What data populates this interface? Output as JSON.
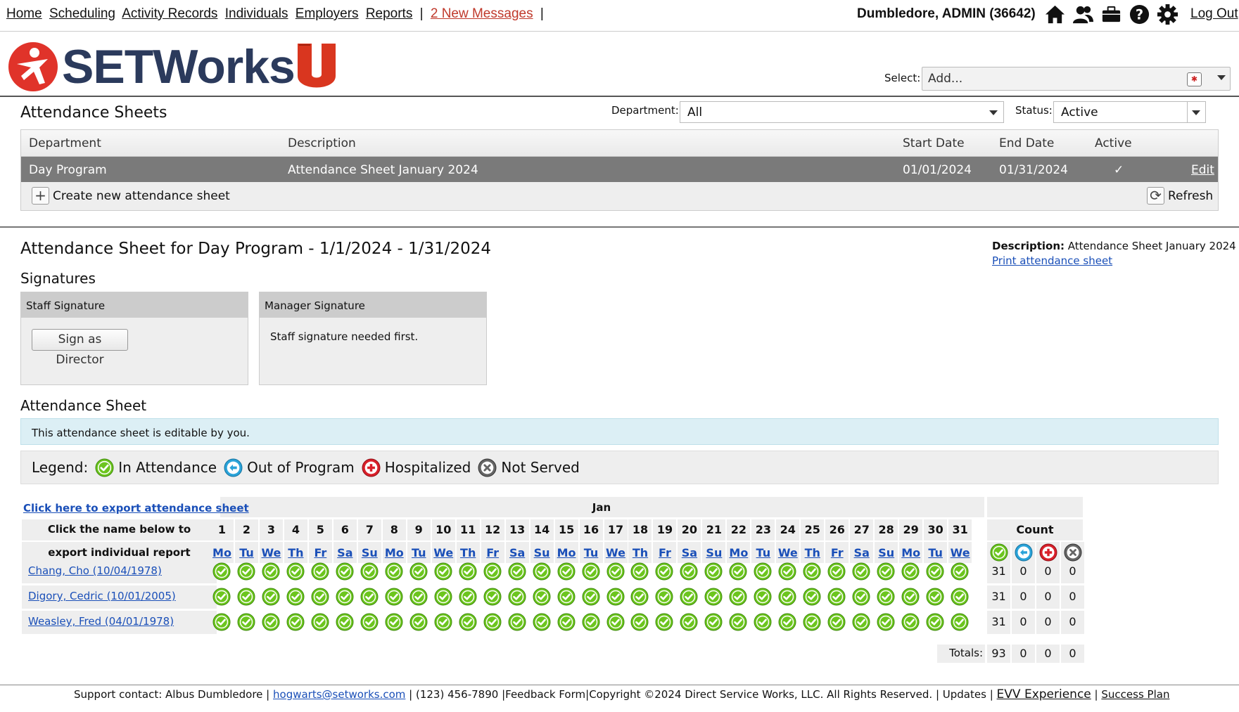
{
  "nav": {
    "links": [
      "Home",
      "Scheduling",
      "Activity Records",
      "Individuals",
      "Employers",
      "Reports"
    ],
    "messages": "2 New Messages",
    "user": "Dumbledore, ADMIN  (36642)",
    "logout": "Log Out",
    "icons": [
      "home-icon",
      "people-icon",
      "briefcase-icon",
      "help-icon",
      "gear-icon"
    ]
  },
  "logo": {
    "text": "SETWorks"
  },
  "select": {
    "label": "Select:",
    "placeholder": "Add..."
  },
  "list": {
    "title": "Attendance Sheets",
    "department_label": "Department:",
    "department_value": "All",
    "status_label": "Status:",
    "status_value": "Active",
    "columns": [
      "Department",
      "Description",
      "Start Date",
      "End Date",
      "Active"
    ],
    "row": {
      "department": "Day Program",
      "description": "Attendance Sheet January 2024",
      "start": "01/01/2024",
      "end": "01/31/2024",
      "active": "✓",
      "edit": "Edit"
    },
    "create": "Create new attendance sheet",
    "refresh": "Refresh"
  },
  "sheet": {
    "title": "Attendance Sheet for Day Program - 1/1/2024 - 1/31/2024",
    "desc_label": "Description:",
    "desc_value": "Attendance Sheet January 2024",
    "print": "Print attendance sheet"
  },
  "signatures": {
    "title": "Signatures",
    "staff_header": "Staff Signature",
    "sign_button": "Sign as Director",
    "manager_header": "Manager Signature",
    "manager_note": "Staff signature needed first."
  },
  "attendance": {
    "title": "Attendance Sheet",
    "editable_note": "This attendance sheet is editable by you.",
    "legend_label": "Legend:",
    "legend": [
      "In Attendance",
      "Out of Program",
      "Hospitalized",
      "Not Served"
    ],
    "export_link": "Click here to export attendance sheet",
    "month": "Jan",
    "name_hint1": "Click the name below to",
    "name_hint2": "export individual report",
    "count_label": "Count",
    "totals_label": "Totals:",
    "totals": [
      "93",
      "0",
      "0",
      "0"
    ],
    "days": [
      "1",
      "2",
      "3",
      "4",
      "5",
      "6",
      "7",
      "8",
      "9",
      "10",
      "11",
      "12",
      "13",
      "14",
      "15",
      "16",
      "17",
      "18",
      "19",
      "20",
      "21",
      "22",
      "23",
      "24",
      "25",
      "26",
      "27",
      "28",
      "29",
      "30",
      "31"
    ],
    "weekdays": [
      "Mo",
      "Tu",
      "We",
      "Th",
      "Fr",
      "Sa",
      "Su",
      "Mo",
      "Tu",
      "We",
      "Th",
      "Fr",
      "Sa",
      "Su",
      "Mo",
      "Tu",
      "We",
      "Th",
      "Fr",
      "Sa",
      "Su",
      "Mo",
      "Tu",
      "We",
      "Th",
      "Fr",
      "Sa",
      "Su",
      "Mo",
      "Tu",
      "We"
    ],
    "people": [
      {
        "name": "Chang, Cho (10/04/1978)",
        "counts": [
          "31",
          "0",
          "0",
          "0"
        ]
      },
      {
        "name": "Digory, Cedric (10/01/2005)",
        "counts": [
          "31",
          "0",
          "0",
          "0"
        ]
      },
      {
        "name": "Weasley, Fred (04/01/1978)",
        "counts": [
          "31",
          "0",
          "0",
          "0"
        ]
      }
    ],
    "status_all_days": "In Attendance"
  },
  "footer": {
    "support": "Support contact: Albus Dumbledore  |",
    "email": "hogwarts@setworks.com",
    "phone": "| (123) 456-7890 |",
    "feedback": "Feedback Form",
    "copyright": "|Copyright ©2024 Direct Service Works, LLC. All Rights Reserved.  |",
    "updates": "Updates",
    "sep": "|",
    "evv": "EVV Experience",
    "success": "Success Plan"
  },
  "colors": {
    "attend": "#6cc51e",
    "out": "#2aa3d9",
    "hosp": "#d9202a",
    "notserved": "#666666",
    "selected_row": "#7a7a7a"
  }
}
